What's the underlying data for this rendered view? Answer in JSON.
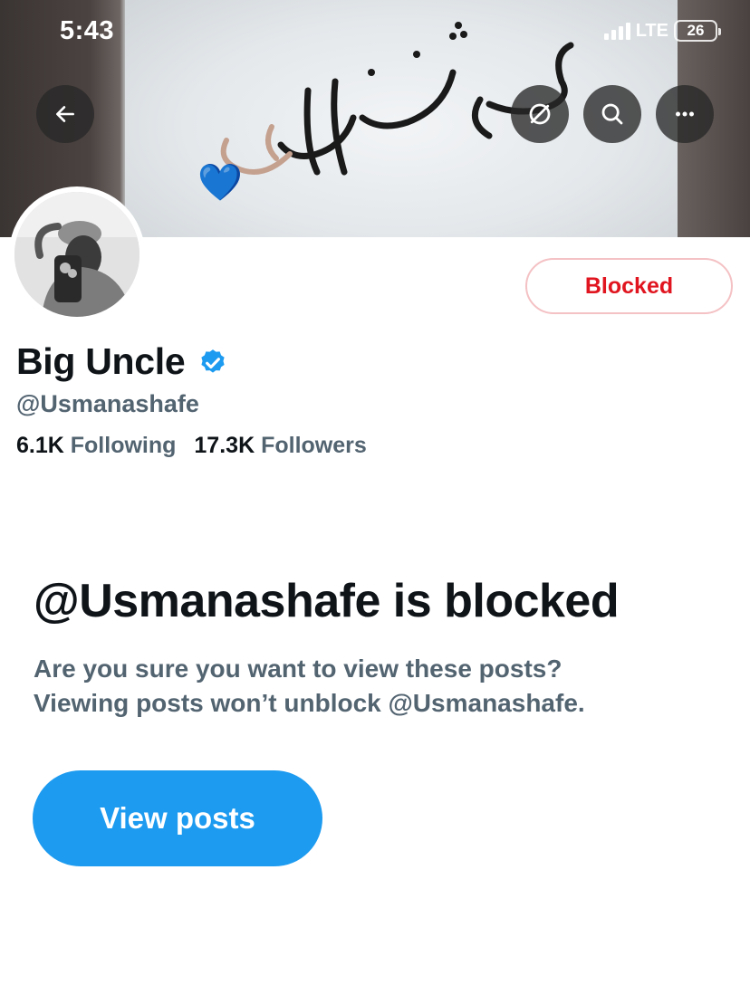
{
  "status_bar": {
    "time": "5:43",
    "network": "LTE",
    "battery": "26"
  },
  "header": {
    "back_icon": "arrow-left-icon",
    "nosync_icon": "circle-slash-icon",
    "search_icon": "search-icon",
    "more_icon": "ellipsis-icon"
  },
  "banner": {
    "emoji": "💙"
  },
  "profile": {
    "display_name": "Big Uncle",
    "handle": "@Usmanashafe",
    "verified": true,
    "relationship_button": "Blocked",
    "following_count": "6.1K",
    "following_label": "Following",
    "followers_count": "17.3K",
    "followers_label": "Followers"
  },
  "blocked_notice": {
    "title": "@Usmanashafe is blocked",
    "line1": "Are you sure you want to view these posts?",
    "line2": "Viewing posts won’t unblock @Usmanashafe.",
    "button": "View posts"
  },
  "colors": {
    "accent": "#1d9bf0",
    "blocked_red": "#e0151f",
    "secondary_text": "#536471",
    "primary_text": "#0f1419"
  }
}
